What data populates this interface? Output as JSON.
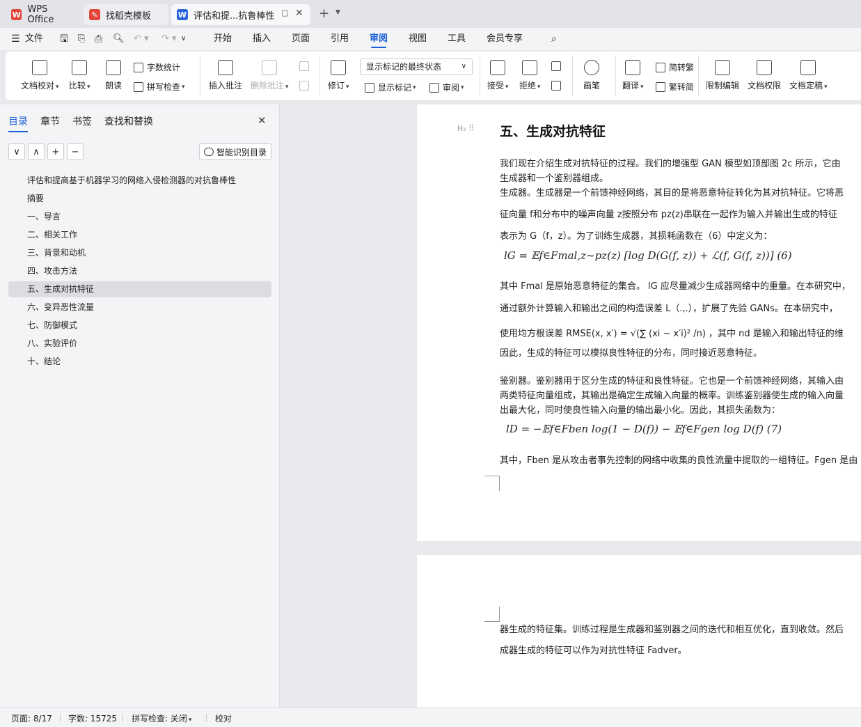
{
  "tabs": [
    {
      "label": "WPS Office"
    },
    {
      "label": "找稻壳模板"
    },
    {
      "label": "评估和提...抗鲁棒性"
    }
  ],
  "menu": {
    "file": "文件",
    "items": [
      "开始",
      "插入",
      "页面",
      "引用",
      "审阅",
      "视图",
      "工具",
      "会员专享"
    ],
    "active": "审阅"
  },
  "ribbon": {
    "doc_check": "文档校对",
    "compare": "比较",
    "read_aloud": "朗读",
    "word_count": "字数统计",
    "spell_check": "拼写检查",
    "insert_comment": "插入批注",
    "delete_comment": "删除批注",
    "revise": "修订",
    "markup_state": "显示标记的最终状态",
    "show_markup": "显示标记",
    "review": "审阅",
    "accept": "接受",
    "reject": "拒绝",
    "pen": "画笔",
    "translate": "翻译",
    "to_traditional": "繁转简",
    "to_traditional_top": "简转繁",
    "restrict_edit": "限制编辑",
    "doc_permission": "文档权限",
    "doc_finalize": "文档定稿"
  },
  "sidebar": {
    "tabs": [
      "目录",
      "章节",
      "书签",
      "查找和替换"
    ],
    "smart_toc": "智能识别目录",
    "toc": [
      "评估和提高基于机器学习的网络入侵检测器的对抗鲁棒性",
      "摘要",
      "一、导言",
      "二、相关工作",
      "三、背景和动机",
      "四、攻击方法",
      "五、生成对抗特征",
      "六、变异恶性流量",
      "七、防御模式",
      "八、实验评价",
      "十、结论"
    ],
    "selected_index": 6
  },
  "document": {
    "heading": "五、生成对抗特征",
    "lines": [
      "我们现在介绍生成对抗特征的过程。我们的增强型 GAN 模型如顶部图 2c 所示，它由",
      "生成器和一个鉴别器组成。",
      "生成器。生成器是一个前馈神经网络，其目的是将恶意特征转化为其对抗特征。它将恶",
      "征向量 f和分布中的噪声向量 z按照分布 pz(z)串联在一起作为输入并输出生成的特征",
      "表示为 G（f，z）。为了训练生成器，其损耗函数在（6）中定义为：",
      "其中 Fmal 是原始恶意特征的集合。 lG 应尽量减少生成器网络中的重量。在本研究中，",
      "通过额外计算输入和输出之间的构造误差 L（.,.），扩展了先验 GANs。在本研究中，",
      "使用均方根误差 RMSE(x, x′) = √(∑ (xi − x′i)² /n) ，其中 nd 是输入和输出特征的维",
      "因此，生成的特征可以模拟良性特征的分布，同时接近恶意特征。",
      "鉴别器。鉴别器用于区分生成的特征和良性特征。它也是一个前馈神经网络，其输入由",
      "两类特征向量组成，其输出是确定生成输入向量的概率。训练鉴别器使生成的输入向量",
      "出最大化，同时使良性输入向量的输出最小化。因此，其损失函数为：",
      "其中，Fben 是从攻击者事先控制的网络中收集的良性流量中提取的一组特征。Fgen 是由"
    ],
    "eq6": "lG = 𝔼f∈Fmal,z~pz(z) [log D(G(f, z)) + ℒ(f, G(f, z))]   (6)",
    "eq7": "lD = −𝔼f∈Fben log(1 − D(f)) − 𝔼f∈Fgen log D(f)    (7)",
    "page2_lines": [
      "器生成的特征集。训练过程是生成器和鉴别器之间的迭代和相互优化，直到收敛。然后",
      "成器生成的特征可以作为对抗性特征 Fadver。"
    ]
  },
  "status": {
    "page": "页面: 8/17",
    "words": "字数: 15725",
    "spell": "拼写检查: 关闭",
    "proof": "校对"
  }
}
